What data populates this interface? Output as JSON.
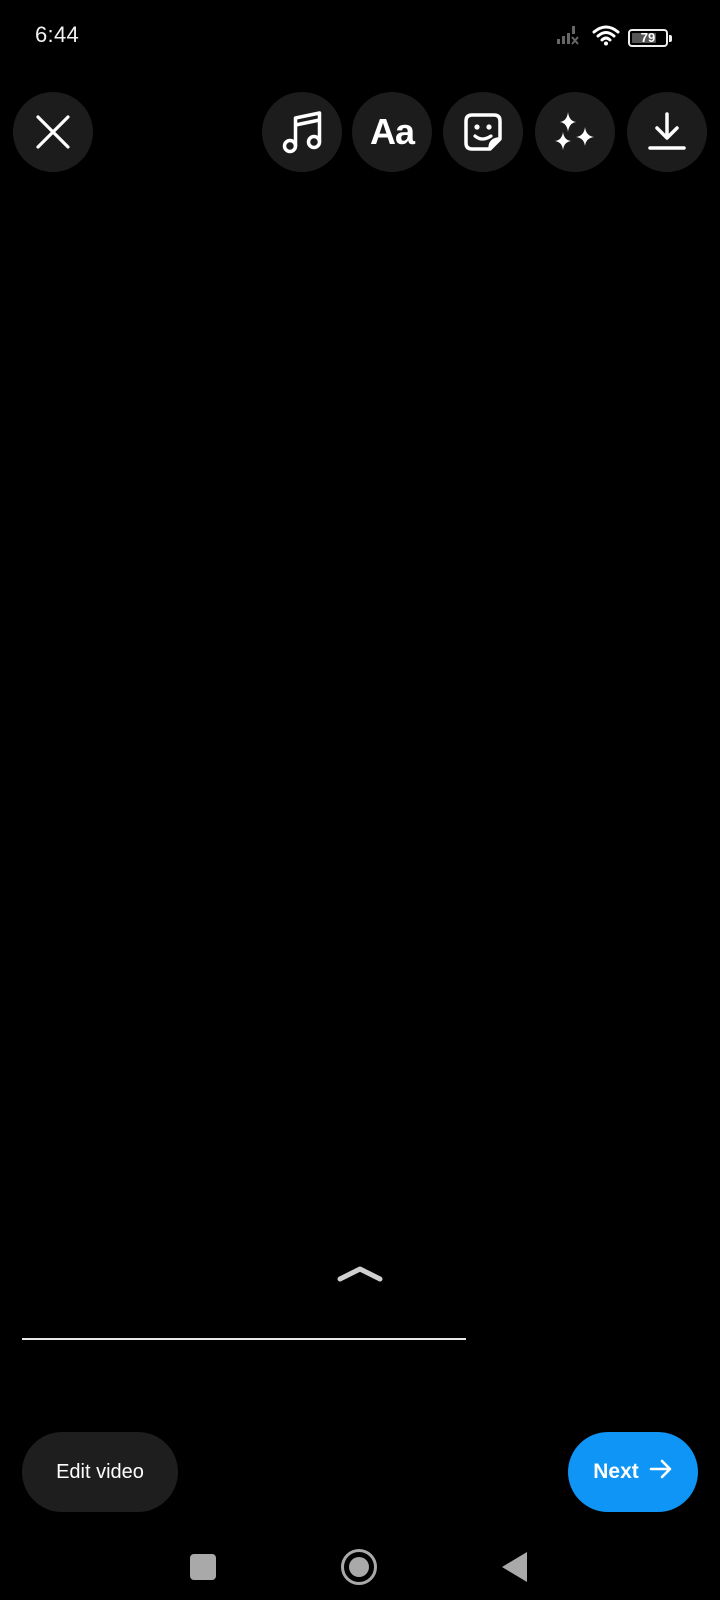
{
  "status_bar": {
    "time": "6:44",
    "battery_level": 79,
    "battery_label": "79",
    "icons": [
      "signal-no-service-icon",
      "wifi-icon",
      "battery-icon"
    ]
  },
  "toolbar": {
    "buttons": [
      {
        "name": "close",
        "icon": "close-icon"
      },
      {
        "name": "music",
        "icon": "music-note-icon"
      },
      {
        "name": "text",
        "icon": "text-icon",
        "label": "Aa"
      },
      {
        "name": "sticker",
        "icon": "sticker-icon"
      },
      {
        "name": "effects",
        "icon": "sparkles-icon"
      },
      {
        "name": "download",
        "icon": "download-icon"
      }
    ]
  },
  "swipe_hint": {
    "icon": "chevron-up-icon"
  },
  "actions": {
    "edit_video_label": "Edit video",
    "next_label": "Next",
    "next_icon": "arrow-right-icon",
    "accent_color": "#0f95f5"
  },
  "nav_bar": {
    "items": [
      "recents",
      "home",
      "back"
    ]
  }
}
